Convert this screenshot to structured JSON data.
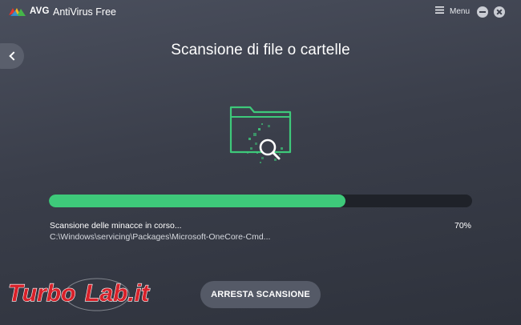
{
  "app": {
    "brand": "AVG",
    "title": "AntiVirus Free"
  },
  "titlebar": {
    "menu_label": "Menu"
  },
  "page": {
    "title": "Scansione di file o cartelle"
  },
  "scan": {
    "progress": 0.7,
    "percent_label": "70%",
    "status": "Scansione delle minacce in corso...",
    "current_path": "C:\\Windows\\servicing\\Packages\\Microsoft-OneCore-Cmd..."
  },
  "actions": {
    "stop_label": "ARRESTA SCANSIONE"
  },
  "watermark": {
    "text": "TurboLab.it"
  },
  "colors": {
    "accent": "#3ec97a",
    "track": "#1f2229",
    "button": "#555a67"
  }
}
